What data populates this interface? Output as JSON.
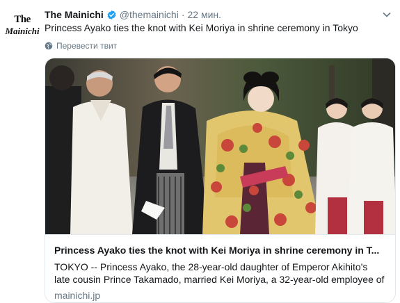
{
  "author": {
    "logo_line1": "The",
    "logo_line2": "Mainichi",
    "name": "The Mainichi",
    "handle": "@themainichi",
    "separator": "·",
    "time": "22 мин."
  },
  "tweet": {
    "text": "Princess Ayako ties the knot with Kei Moriya in shrine ceremony in Tokyo",
    "translate_label": "Перевести твит"
  },
  "card": {
    "title": "Princess Ayako ties the knot with Kei Moriya in shrine ceremony in T...",
    "description_lines": [
      "TOKYO -- Princess Ayako, the 28-year-old daughter of Emperor Akihito's",
      "late cousin Prince Takamado, married Kei Moriya, a 32-year-old employee of"
    ],
    "domain": "mainichi.jp"
  },
  "colors": {
    "verified": "#1da1f2",
    "secondary_text": "#657786",
    "border": "#e1e8ed"
  },
  "icons": [
    "verified-badge-icon",
    "chevron-down-icon",
    "globe-icon"
  ]
}
